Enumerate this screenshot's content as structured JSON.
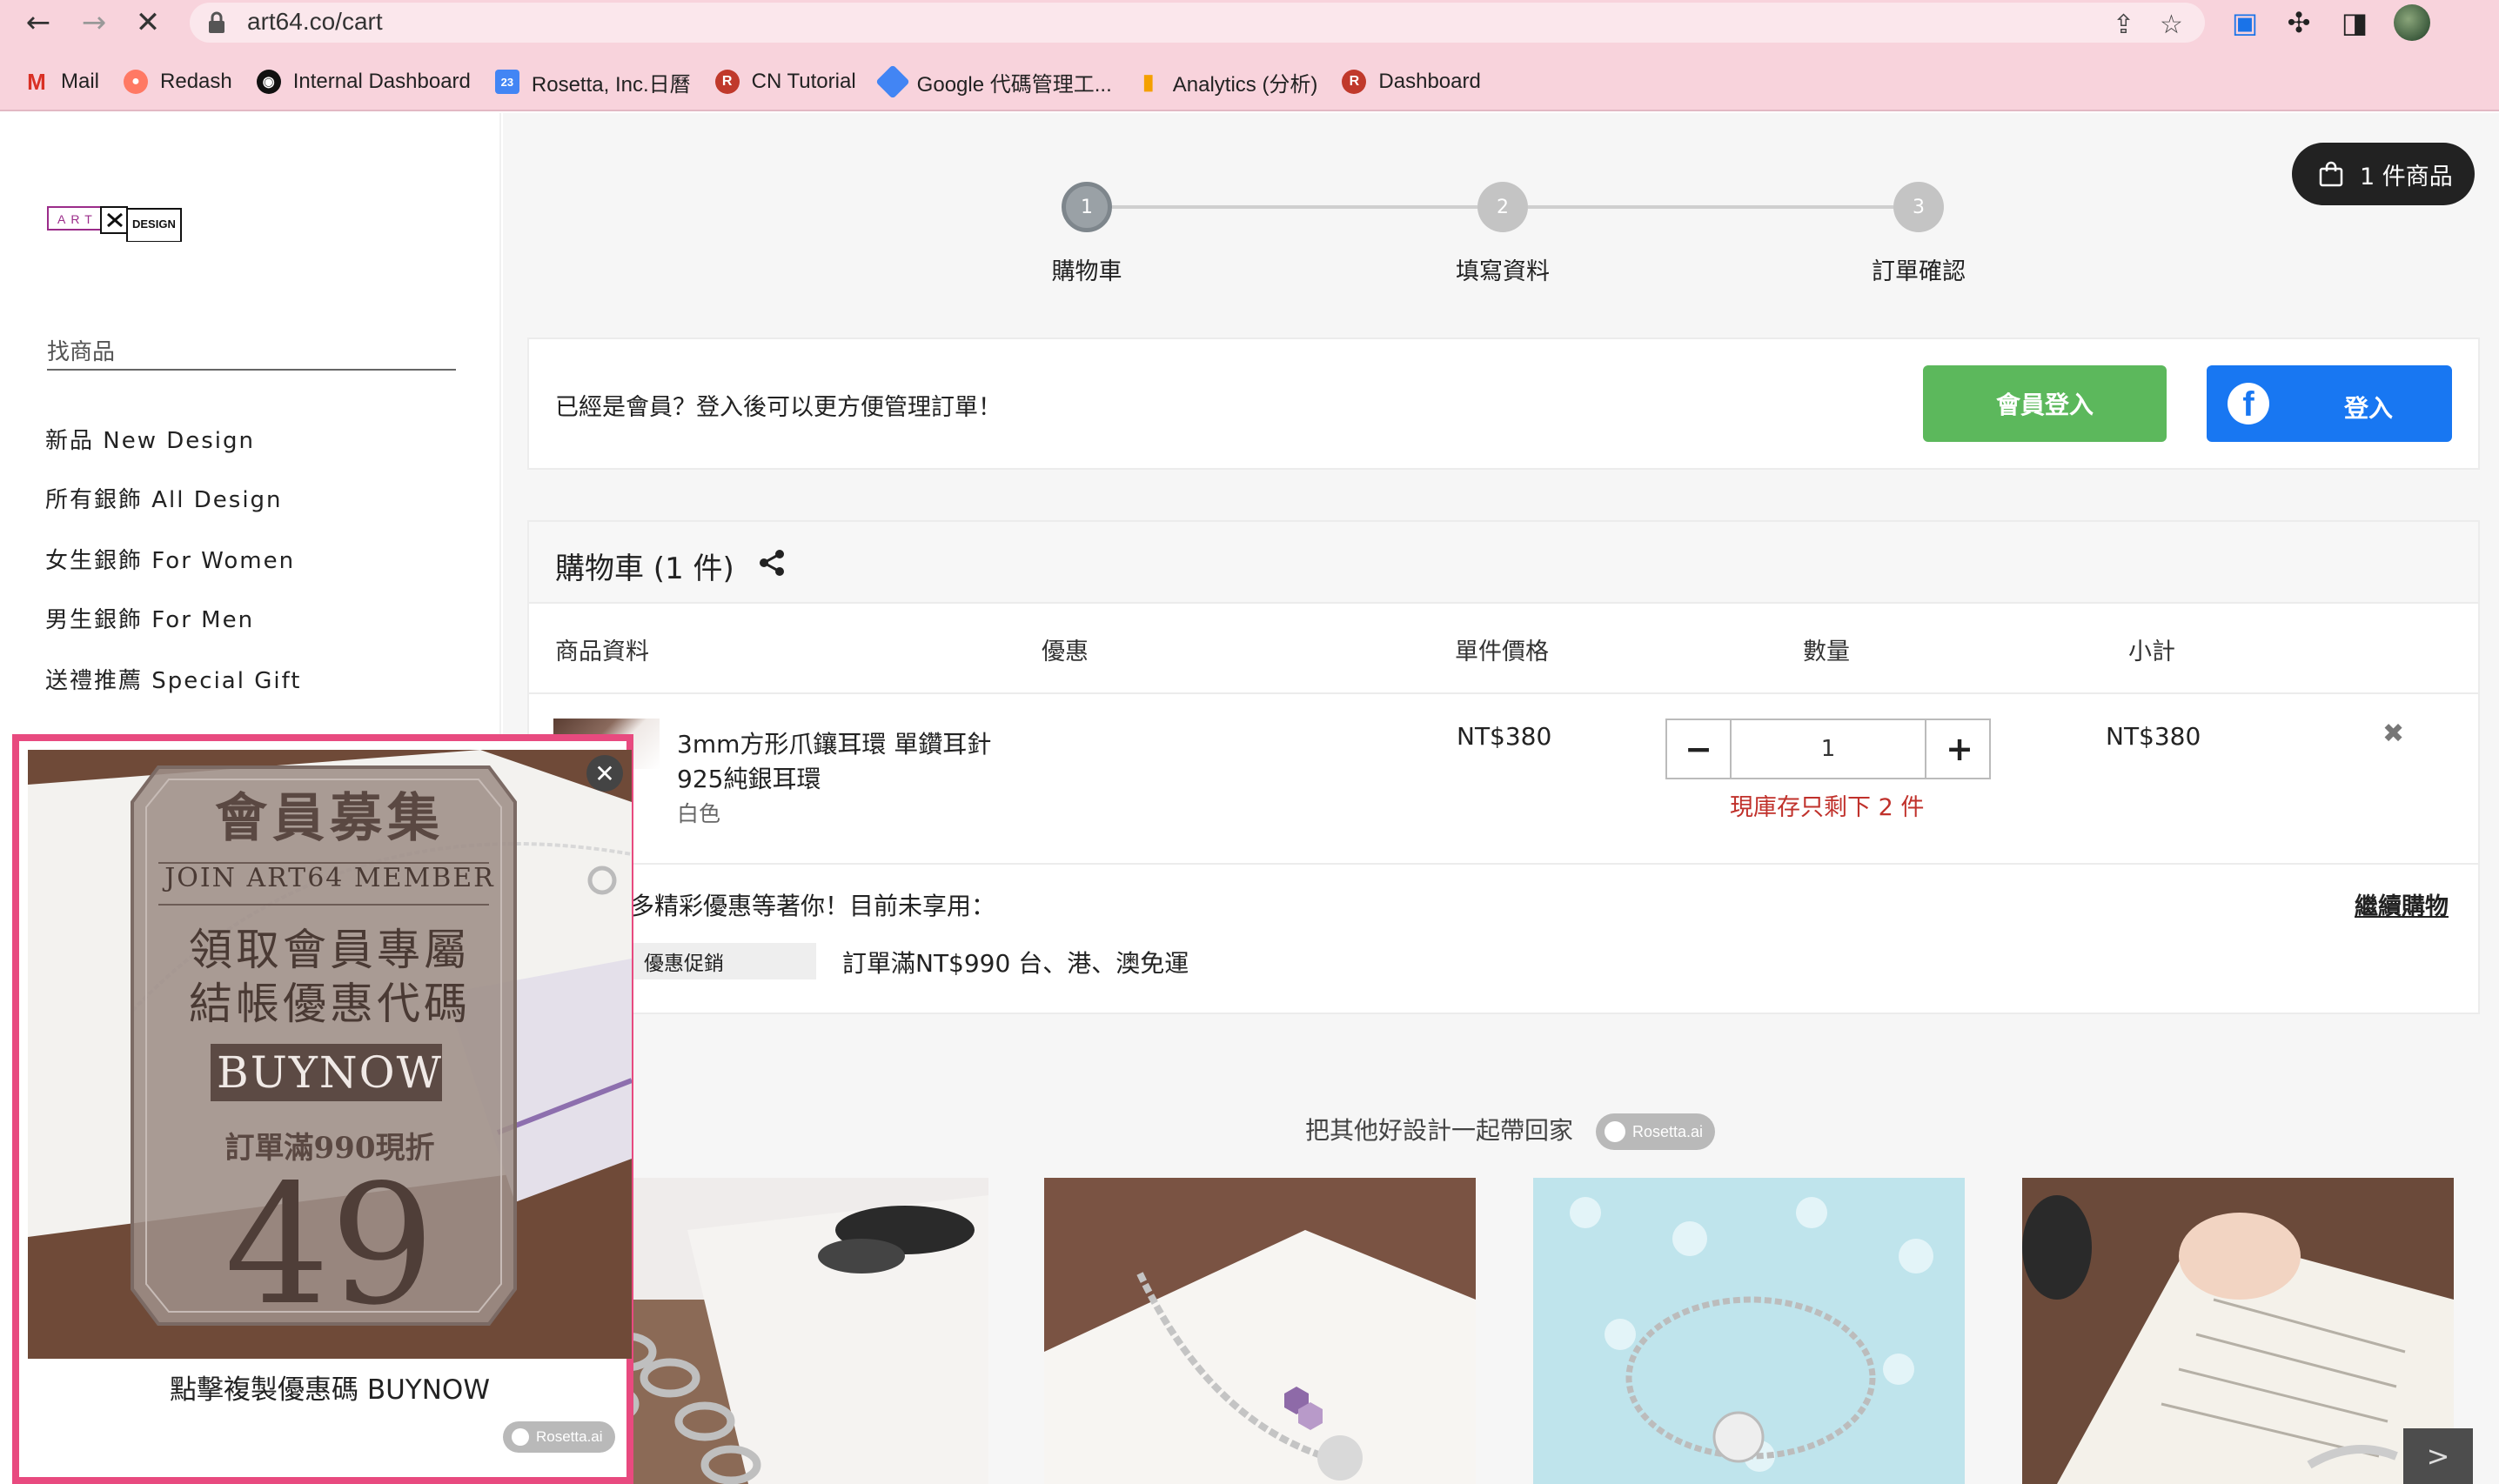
{
  "browser": {
    "url": "art64.co/cart",
    "bookmarks": [
      {
        "label": "Mail",
        "icon": "gmail-icon",
        "color": "#d93025"
      },
      {
        "label": "Redash",
        "icon": "redash-icon",
        "color": "#ff7964"
      },
      {
        "label": "Internal Dashboard",
        "icon": "github-icon",
        "color": "#111111"
      },
      {
        "label": "Rosetta, Inc.日曆",
        "icon": "calendar-icon",
        "color": "#4285f4"
      },
      {
        "label": "CN Tutorial",
        "icon": "rosetta-icon",
        "color": "#c0392b"
      },
      {
        "label": "Google 代碼管理工...",
        "icon": "tag-manager-icon",
        "color": "#4285f4"
      },
      {
        "label": "Analytics (分析)",
        "icon": "analytics-icon",
        "color": "#f4a000"
      },
      {
        "label": "Dashboard",
        "icon": "rosetta-icon",
        "color": "#c0392b"
      }
    ]
  },
  "sidebar": {
    "logo_text_left": "ART",
    "logo_text_right": "DESIGN",
    "search_placeholder": "找商品",
    "items": [
      "新品 New Design",
      "所有銀飾 All Design",
      "女生銀飾 For Women",
      "男生銀飾 For Men",
      "送禮推薦 Special Gift"
    ]
  },
  "cart_pill": "1 件商品",
  "steps": [
    {
      "num": "1",
      "label": "購物車",
      "active": true
    },
    {
      "num": "2",
      "label": "填寫資料",
      "active": false
    },
    {
      "num": "3",
      "label": "訂單確認",
      "active": false
    }
  ],
  "login": {
    "prompt": "已經是會員？登入後可以更方便管理訂單！",
    "member_button": "會員登入",
    "fb_button": "登入",
    "fb_glyph": "f"
  },
  "cart": {
    "title": "購物車  (1 件)",
    "columns": [
      "商品資料",
      "優惠",
      "單件價格",
      "數量",
      "小計"
    ],
    "item": {
      "name_line1": "3mm方形爪鑲耳環 單鑽耳針",
      "name_line2": "925純銀耳環",
      "variant": "白色",
      "price": "NT$380",
      "quantity": "1",
      "stock_note": "現庫存只剩下 2 件",
      "subtotal": "NT$380",
      "minus": "−",
      "plus": "+",
      "remove": "✖"
    },
    "promo_text": "多精彩優惠等著你！目前未享用：",
    "continue_link": "繼續購物",
    "promo_tag": "優惠促銷",
    "promo_detail": "訂單滿NT$990 台、港、澳免運"
  },
  "recommend": {
    "title": "把其他好設計一起帶回家",
    "badge": "Rosetta.ai",
    "arrow": ">"
  },
  "popup": {
    "close": "✕",
    "headline": "會員募集",
    "subline": "JOIN ART64 MEMBER",
    "line1": "領取會員專屬",
    "line2": "結帳優惠代碼",
    "code": "BUYNOW",
    "condition": "訂單滿990現折",
    "amount": "49",
    "caption": "點擊複製優惠碼 BUYNOW",
    "badge": "Rosetta.ai"
  }
}
